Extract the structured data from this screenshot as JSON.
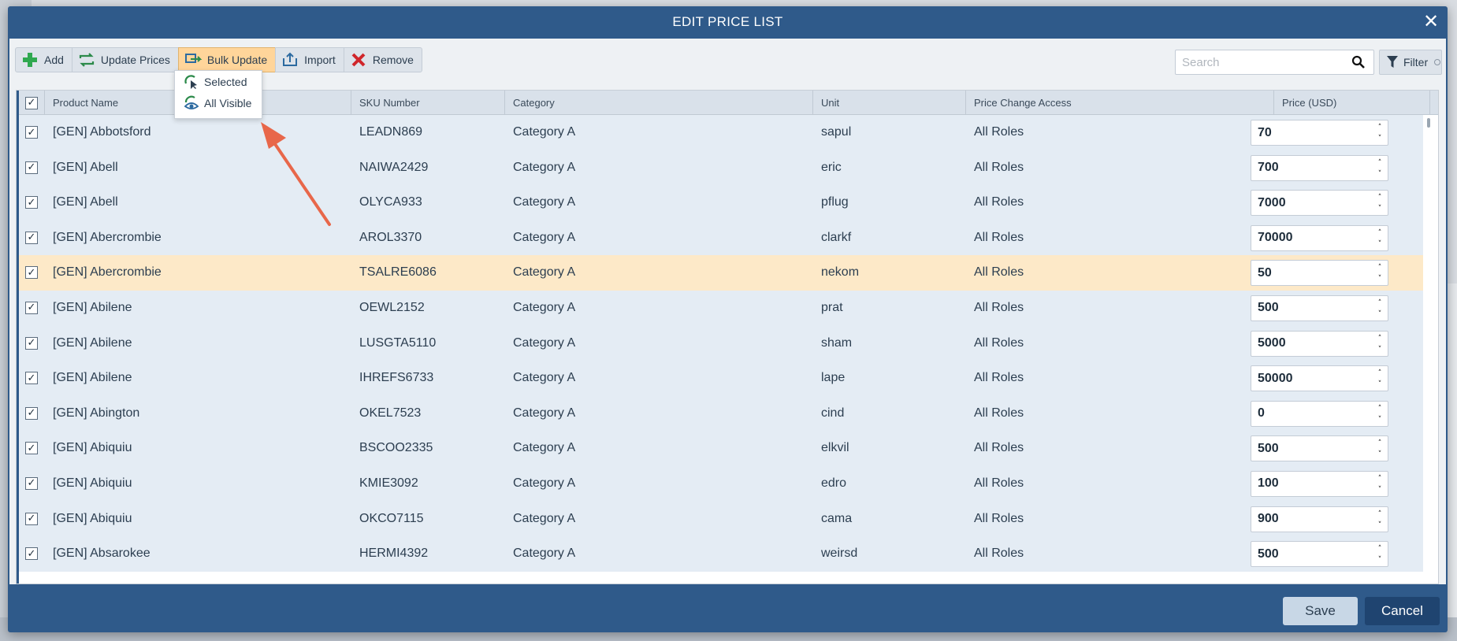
{
  "modal": {
    "title": "EDIT PRICE LIST",
    "close_label": "✕"
  },
  "toolbar": {
    "add": "Add",
    "update_prices": "Update Prices",
    "bulk_update": "Bulk Update",
    "import": "Import",
    "remove": "Remove",
    "search_placeholder": "Search",
    "filter": "Filter"
  },
  "bulk_menu": {
    "items": [
      "Selected",
      "All Visible"
    ]
  },
  "table": {
    "columns": [
      "Product Name",
      "SKU Number",
      "Category",
      "Unit",
      "Price Change Access",
      "Price (USD)"
    ],
    "rows": [
      {
        "name": "[GEN] Abbotsford",
        "sku": "LEADN869",
        "category": "Category A",
        "unit": "sapul",
        "access": "All Roles",
        "price": "70"
      },
      {
        "name": "[GEN] Abell",
        "sku": "NAIWA2429",
        "category": "Category A",
        "unit": "eric",
        "access": "All Roles",
        "price": "700"
      },
      {
        "name": "[GEN] Abell",
        "sku": "OLYCA933",
        "category": "Category A",
        "unit": "pflug",
        "access": "All Roles",
        "price": "7000"
      },
      {
        "name": "[GEN] Abercrombie",
        "sku": "AROL3370",
        "category": "Category A",
        "unit": "clarkf",
        "access": "All Roles",
        "price": "70000"
      },
      {
        "name": "[GEN] Abercrombie",
        "sku": "TSALRE6086",
        "category": "Category A",
        "unit": "nekom",
        "access": "All Roles",
        "price": "50"
      },
      {
        "name": "[GEN] Abilene",
        "sku": "OEWL2152",
        "category": "Category A",
        "unit": "prat",
        "access": "All Roles",
        "price": "500"
      },
      {
        "name": "[GEN] Abilene",
        "sku": "LUSGTA5110",
        "category": "Category A",
        "unit": "sham",
        "access": "All Roles",
        "price": "5000"
      },
      {
        "name": "[GEN] Abilene",
        "sku": "IHREFS6733",
        "category": "Category A",
        "unit": "lape",
        "access": "All Roles",
        "price": "50000"
      },
      {
        "name": "[GEN] Abington",
        "sku": "OKEL7523",
        "category": "Category A",
        "unit": "cind",
        "access": "All Roles",
        "price": "0"
      },
      {
        "name": "[GEN] Abiquiu",
        "sku": "BSCOO2335",
        "category": "Category A",
        "unit": "elkvil",
        "access": "All Roles",
        "price": "500"
      },
      {
        "name": "[GEN] Abiquiu",
        "sku": "KMIE3092",
        "category": "Category A",
        "unit": "edro",
        "access": "All Roles",
        "price": "100"
      },
      {
        "name": "[GEN] Abiquiu",
        "sku": "OKCO7115",
        "category": "Category A",
        "unit": "cama",
        "access": "All Roles",
        "price": "900"
      },
      {
        "name": "[GEN] Absarokee",
        "sku": "HERMI4392",
        "category": "Category A",
        "unit": "weirsd",
        "access": "All Roles",
        "price": "500"
      }
    ]
  },
  "footer": {
    "save": "Save",
    "cancel": "Cancel"
  },
  "colors": {
    "header_blue": "#2f5a8a",
    "highlight_row": "#fde9c8",
    "active_button": "#ffd59a",
    "annotation_arrow": "#e8674a"
  }
}
